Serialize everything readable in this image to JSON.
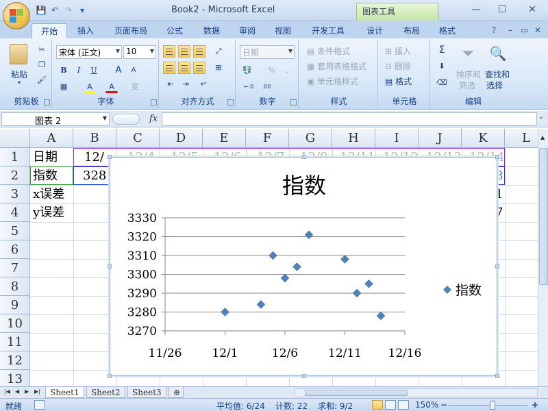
{
  "window": {
    "title": "Book2 - Microsoft Excel",
    "context_tab": "图表工具",
    "minimize": "—",
    "restore": "☐",
    "close": "✕"
  },
  "quick_access": {
    "save": "💾",
    "undo": "↶",
    "redo": "↷",
    "customize": "▾"
  },
  "ribbon_tabs": {
    "home": "开始",
    "insert": "插入",
    "page_layout": "页面布局",
    "formulas": "公式",
    "data": "数据",
    "review": "审阅",
    "view": "视图",
    "developer": "开发工具",
    "design": "设计",
    "layout": "布局",
    "format": "格式",
    "help": "?",
    "min": "–",
    "restore": "▭",
    "close": "✕"
  },
  "ribbon": {
    "clipboard": {
      "label": "剪贴板",
      "paste": "粘贴"
    },
    "font": {
      "label": "字体",
      "font_name": "宋体 (正文)",
      "font_size": "10",
      "bold": "B",
      "italic": "I",
      "underline": "U",
      "grow": "A",
      "shrink": "A",
      "fill": "A",
      "color": "A",
      "phonetic": "变"
    },
    "alignment": {
      "label": "对齐方式"
    },
    "number": {
      "label": "数字",
      "format": "日期",
      "percent": "%",
      "comma": ",",
      "inc": "←.0",
      "dec": ".00"
    },
    "styles": {
      "label": "样式",
      "conditional": "条件格式",
      "table": "套用表格格式",
      "cell": "单元格样式"
    },
    "cells": {
      "label": "单元格",
      "insert": "插入",
      "delete": "删除",
      "format": "格式"
    },
    "editing": {
      "label": "编辑",
      "sort": "排序和",
      "filter": "筛选",
      "find": "查找和",
      "select": "选择",
      "sigma": "Σ"
    }
  },
  "formula_bar": {
    "name_box": "图表 2",
    "fx": "fx",
    "value": ""
  },
  "columns": [
    "A",
    "B",
    "C",
    "D",
    "E",
    "F",
    "G",
    "H",
    "I",
    "J",
    "K",
    "L"
  ],
  "rows": [
    "1",
    "2",
    "3",
    "4",
    "5",
    "6",
    "7",
    "8",
    "9",
    "10",
    "11",
    "12",
    "13"
  ],
  "cells": {
    "a1": "日期",
    "a2": "指数",
    "a3": "x误差",
    "a4": "y误差",
    "b1": "12/",
    "b2": "328",
    "c1": "12/4",
    "d1": "12/5",
    "e1": "12/6",
    "f1": "12/7",
    "g1": "12/8",
    "h1": "12/11",
    "i1": "12/12",
    "j1": "12/13",
    "k1": "12/14",
    "k2": "8",
    "k3": "1",
    "k4": "7"
  },
  "chart_data": {
    "type": "scatter",
    "title": "指数",
    "x_ticks": [
      "11/26",
      "12/1",
      "12/6",
      "12/11",
      "12/16"
    ],
    "x_tick_values": [
      -5,
      0,
      5,
      10,
      15
    ],
    "xlim": [
      -5,
      15
    ],
    "ylim": [
      3270,
      3330
    ],
    "y_ticks": [
      3270,
      3280,
      3290,
      3300,
      3310,
      3320,
      3330
    ],
    "grid": "horizontal",
    "legend_position": "right",
    "series": [
      {
        "name": "指数",
        "color": "#4f81bd",
        "x": [
          "12/1",
          "12/4",
          "12/5",
          "12/6",
          "12/7",
          "12/8",
          "12/11",
          "12/12",
          "12/13",
          "12/14"
        ],
        "x_values": [
          0,
          3,
          4,
          5,
          6,
          7,
          10,
          11,
          12,
          13
        ],
        "y": [
          3280,
          3284,
          3310,
          3298,
          3304,
          3321,
          3308,
          3290,
          3295,
          3278
        ]
      }
    ]
  },
  "sheets": [
    "Sheet1",
    "Sheet2",
    "Sheet3"
  ],
  "status": {
    "ready": "就绪",
    "average": "平均值: 6/24",
    "count": "计数: 22",
    "sum": "求和: 9/2",
    "zoom": "150%",
    "zoom_out": "−",
    "zoom_in": "+"
  }
}
